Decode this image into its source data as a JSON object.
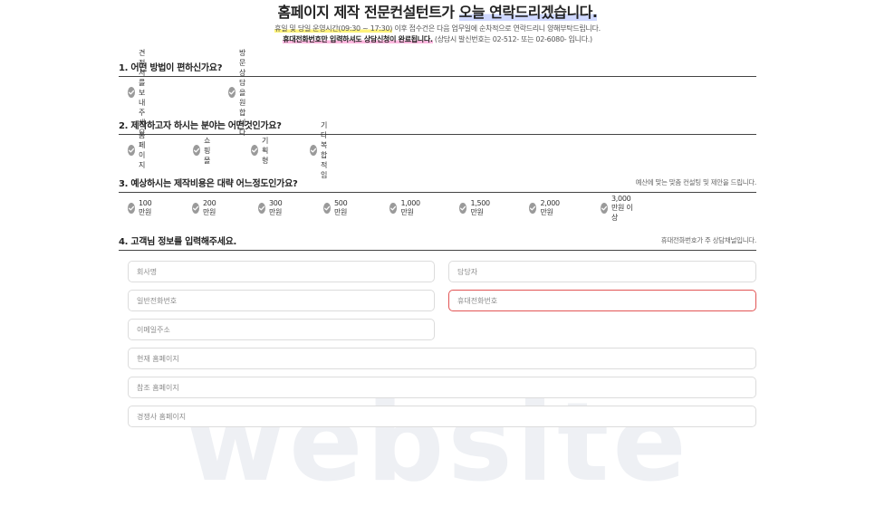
{
  "header": {
    "title_part1": "홈페이지 제작 전문컨설턴트가",
    "title_part2": "오늘 연락드리겠습니다.",
    "sub1_highlight": "휴일 및 당일 운영시간(09:30 ~ 17:30)",
    "sub1_rest": " 이후 접수건은 다음 업무일에 순차적으로 연락드리니 양해부탁드립니다.",
    "sub2_highlight": "휴대전화번호만 입력하셔도 상담신청이 완료됩니다.",
    "sub2_rest": " (상담시 발신번호는 02-512- 또는 02-6080- 입니다.)"
  },
  "sections": {
    "s1": {
      "title": "1. 어떤 방법이 편하신가요?",
      "note": ""
    },
    "s2": {
      "title": "2. 제작하고자 하시는 분야는 어떤것인가요?",
      "note": ""
    },
    "s3": {
      "title": "3. 예상하시는 제작비용은 대략 어느정도인가요?",
      "note": "예산에 맞는 맞춤 컨설팅 및 제안을 드립니다."
    },
    "s4": {
      "title": "4. 고객님 정보를 입력해주세요.",
      "note": "휴대전화번호가 주 상담채널입니다."
    }
  },
  "options": {
    "method": [
      "견적서를 보내주세요.",
      "방문상담을 원합니다."
    ],
    "field": [
      "홈페이지",
      "쇼핑몰",
      "기획형",
      "기타 복합적임"
    ],
    "budget": [
      "100만원",
      "200만원",
      "300만원",
      "500만원",
      "1,000만원",
      "1,500만원",
      "2,000만원",
      "3,000만원 이상"
    ]
  },
  "form": {
    "company": {
      "placeholder": "회사명",
      "value": ""
    },
    "manager": {
      "placeholder": "담당자",
      "value": ""
    },
    "phone": {
      "placeholder": "일반전화번호",
      "value": ""
    },
    "mobile": {
      "placeholder": "휴대전화번호",
      "value": ""
    },
    "email": {
      "placeholder": "이메일주소",
      "value": ""
    },
    "homepage": {
      "placeholder": "현재 홈페이지",
      "value": ""
    },
    "reference": {
      "placeholder": "참조 홈페이지",
      "value": ""
    },
    "competitor": {
      "placeholder": "경쟁사 홈페이지",
      "value": ""
    }
  },
  "watermark": "website",
  "colors": {
    "check": "#9a9a9a",
    "required_border": "#e25454",
    "title_highlight": "#cfd8ff",
    "yellow_highlight": "#fff37a",
    "pink_highlight": "#ffb8e0"
  }
}
